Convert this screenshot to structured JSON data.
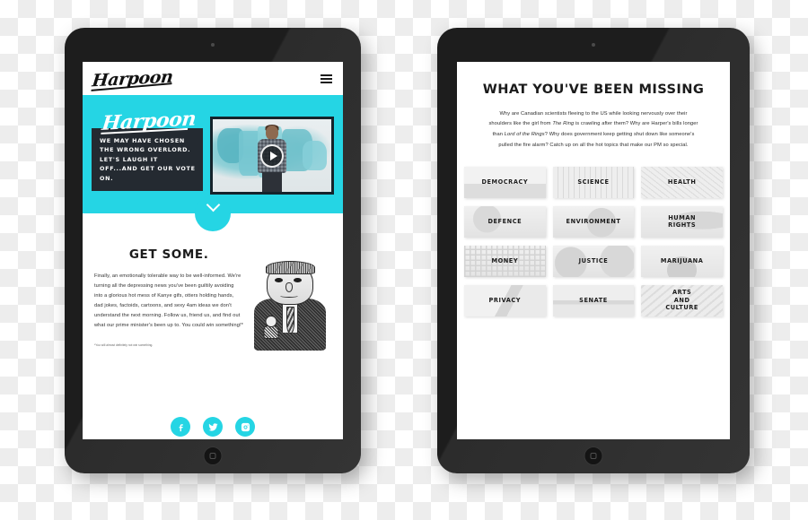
{
  "scene": {
    "background": "transparency-checkerboard",
    "accent_color": "#25D5E4",
    "dark_color": "#242A31"
  },
  "left_tablet": {
    "nav": {
      "logo": "Harpoon",
      "menu_icon": "hamburger-icon"
    },
    "hero": {
      "logo": "Harpoon",
      "tagline": "WE MAY HAVE CHOSEN THE WRONG OVERLORD. LET'S LAUGH IT OFF...AND GET OUR VOTE ON.",
      "video": {
        "play_icon": "play-icon",
        "caption": "Canada map video thumbnail"
      },
      "scroll_icon": "chevron-down-icon"
    },
    "get_some": {
      "title": "GET SOME.",
      "body": "Finally, an emotionally tolerable way to be well-informed. We're turning all the depressing news you've been guiltily avoiding into a glorious hot mess of Kanye gifs, otters holding hands, dad jokes, factoids, cartoons, and sexy 4am ideas we don't understand the next morning. Follow us, friend us, and find out what our prime minister's been up to. You could win something!*",
      "footnote": "*You will almost definitely not win something.",
      "illustration": "politician-caricature"
    },
    "social": [
      {
        "name": "facebook-icon",
        "label": "Facebook"
      },
      {
        "name": "twitter-icon",
        "label": "Twitter"
      },
      {
        "name": "instagram-icon",
        "label": "Instagram"
      }
    ]
  },
  "right_tablet": {
    "title": "WHAT YOU'VE BEEN MISSING",
    "body_parts": [
      "Why are Canadian scientists fleeing to the US while looking nervously over their shoulders like the girl from ",
      "The Ring",
      " is crawling after them? Why are Harper's bills longer than ",
      "Lord of the Rings",
      "? Why does government keep getting shut down like someone's pulled the fire alarm? Catch up on all the hot topics that make our PM so special."
    ],
    "tiles": [
      {
        "label": "DEMOCRACY",
        "art": "art-a"
      },
      {
        "label": "SCIENCE",
        "art": "art-b"
      },
      {
        "label": "HEALTH",
        "art": "art-c"
      },
      {
        "label": "DEFENCE",
        "art": "art-d"
      },
      {
        "label": "ENVIRONMENT",
        "art": "art-e"
      },
      {
        "label": "HUMAN RIGHTS",
        "art": "art-f"
      },
      {
        "label": "MONEY",
        "art": "art-g"
      },
      {
        "label": "JUSTICE",
        "art": "art-h"
      },
      {
        "label": "MARIJUANA",
        "art": "art-i"
      },
      {
        "label": "PRIVACY",
        "art": "art-j"
      },
      {
        "label": "SENATE",
        "art": "art-k"
      },
      {
        "label": "ARTS AND CULTURE",
        "art": "art-l"
      }
    ]
  }
}
